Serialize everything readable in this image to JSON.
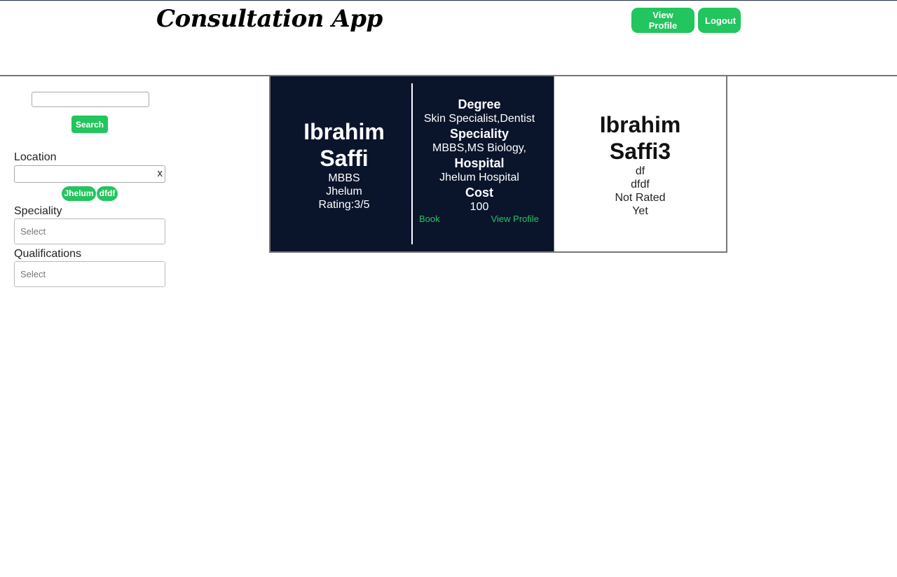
{
  "header": {
    "title": "Consultation App",
    "view_profile_label": "View Profile",
    "logout_label": "Logout"
  },
  "sidebar": {
    "search": {
      "value": "",
      "button_label": "Search"
    },
    "location": {
      "label": "Location",
      "value": "",
      "clear_label": "x",
      "chips": [
        "Jhelum",
        "dfdf"
      ]
    },
    "speciality": {
      "label": "Speciality",
      "placeholder": "Select"
    },
    "qualifications": {
      "label": "Qualifications",
      "placeholder": "Select"
    }
  },
  "results": [
    {
      "name_line1": "Ibrahim",
      "name_line2": "Saffi",
      "qualification": "MBBS",
      "city": "Jhelum",
      "rating": "Rating:3/5",
      "degree_label": "Degree",
      "degree_value": "Skin Specialist,Dentist",
      "speciality_label": "Speciality",
      "speciality_value": "MBBS,MS Biology,",
      "hospital_label": "Hospital",
      "hospital_value": "Jhelum Hospital",
      "cost_label": "Cost",
      "cost_value": "100",
      "book_label": "Book",
      "view_profile_label": "View Profile"
    },
    {
      "name_line1": "Ibrahim",
      "name_line2": "Saffi3",
      "line1": "df",
      "line2": "dfdf",
      "line3": "Not Rated",
      "line4": "Yet"
    }
  ],
  "colors": {
    "accent": "#22c55e",
    "card_dark_bg": "#0a142b",
    "header_rule": "#777777"
  }
}
